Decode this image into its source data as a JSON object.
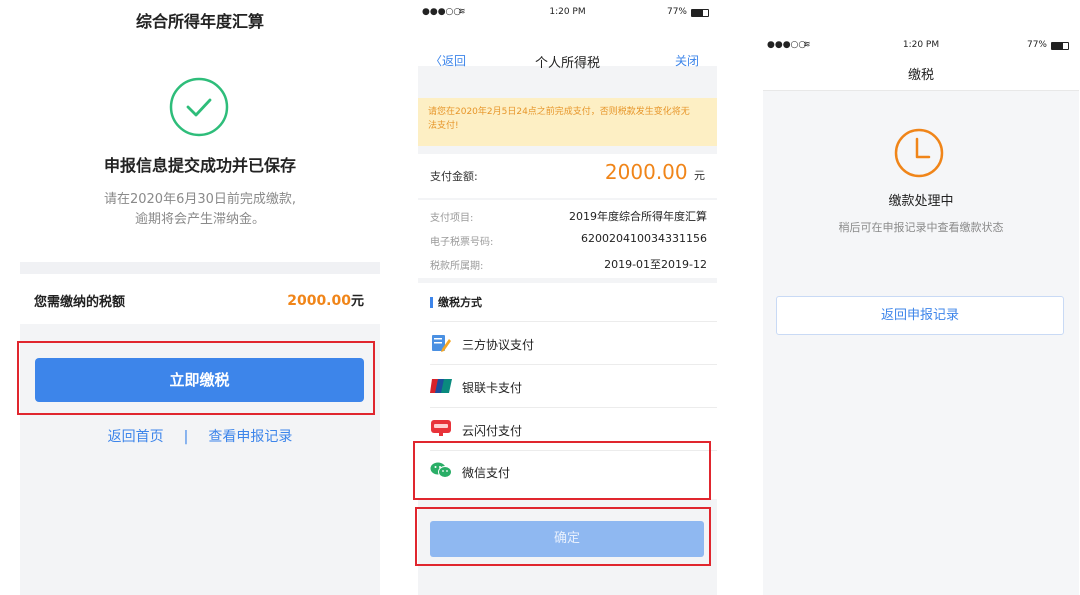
{
  "panel1": {
    "title": "综合所得年度汇算",
    "headline": "申报信息提交成功并已保存",
    "subtext_line1": "请在2020年6月30日前完成缴款,",
    "subtext_line2": "逾期将会产生滞纳金。",
    "amount_label": "您需缴纳的税额",
    "amount_value": "2000.00",
    "amount_unit": "元",
    "pay_button": "立即缴税",
    "link_home": "返回首页",
    "link_separator": "|",
    "link_records": "查看申报记录",
    "colors": {
      "primary": "#3d85ea",
      "success": "#2ebd7a",
      "amount": "#f08519",
      "highlight": "#e0262e"
    }
  },
  "panel2": {
    "status": {
      "signal": "●●●○○",
      "time": "1:20 PM",
      "battery": "77%"
    },
    "nav": {
      "back": "〈返回",
      "title": "个人所得税",
      "close": "关闭"
    },
    "warning": "请您在2020年2月5日24点之前完成支付，否则税款发生变化将无法支付!",
    "pay_label": "支付金额:",
    "pay_amount": "2000.00",
    "pay_unit": "元",
    "details": [
      {
        "label": "支付项目:",
        "value": "2019年度综合所得年度汇算"
      },
      {
        "label": "电子税票号码:",
        "value": "620020410034331156"
      },
      {
        "label": "税款所属期:",
        "value": "2019-01至2019-12"
      }
    ],
    "methods_title": "缴税方式",
    "methods": [
      {
        "label": "三方协议支付",
        "icon": "contract-pen-icon"
      },
      {
        "label": "银联卡支付",
        "icon": "unionpay-icon"
      },
      {
        "label": "云闪付支付",
        "icon": "cloud-quickpass-icon"
      },
      {
        "label": "微信支付",
        "icon": "wechat-pay-icon"
      }
    ],
    "confirm_button": "确定"
  },
  "panel3": {
    "status": {
      "signal": "●●●○○",
      "time": "1:20 PM",
      "battery": "77%"
    },
    "nav_title": "缴税",
    "state": "缴款处理中",
    "state_sub": "稍后可在申报记录中查看缴款状态",
    "back_button": "返回申报记录",
    "colors": {
      "clock": "#f08519"
    }
  }
}
